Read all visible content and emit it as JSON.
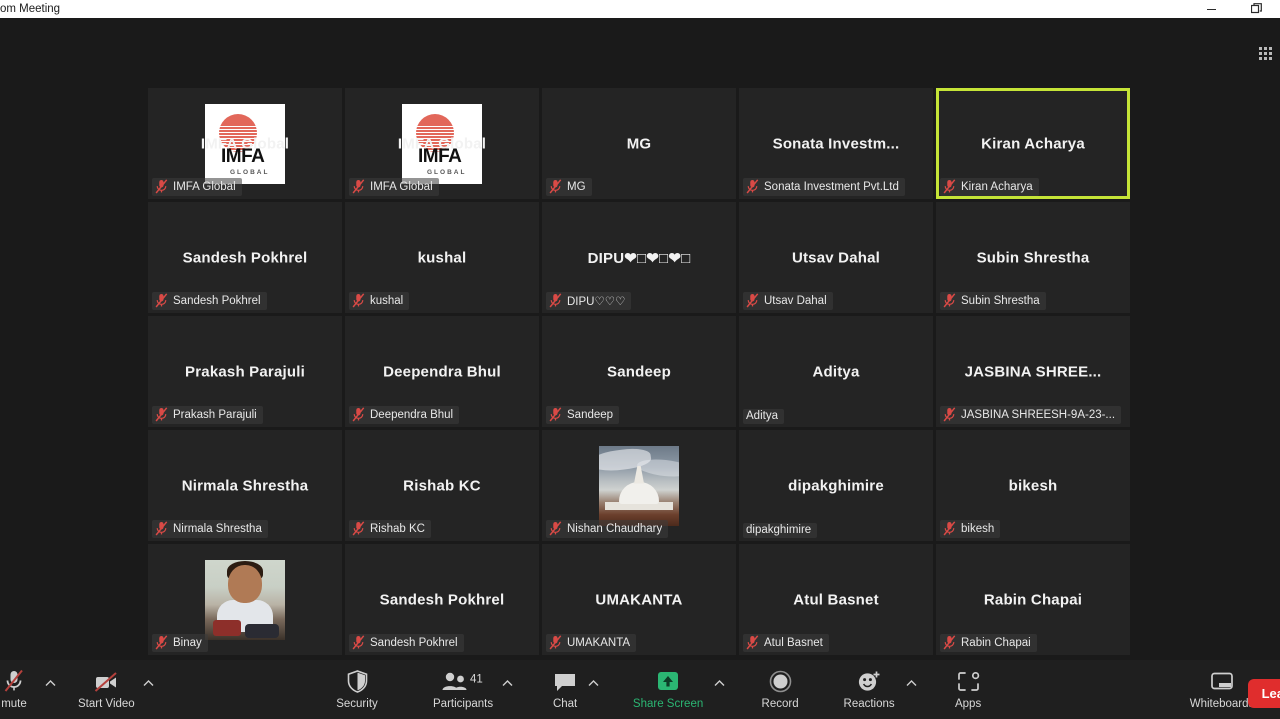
{
  "window": {
    "title": "om Meeting",
    "controls": [
      {
        "name": "minimize-button",
        "glyph": "minimize"
      },
      {
        "name": "restore-button",
        "glyph": "restore"
      }
    ]
  },
  "view": {
    "grid_view_icon": "grid-view-icon"
  },
  "colors": {
    "active_speaker_border": "#c5e437",
    "share_screen_green": "#2bb673",
    "leave_red": "#e02d2d",
    "mute_icon_red": "#d94a46",
    "tile_bg": "#242424",
    "app_bg": "#1a1a1a"
  },
  "gallery": {
    "rows": 5,
    "columns": 5,
    "tiles": [
      {
        "name": "IMFA Global",
        "label": "IMFA Global",
        "muted": true,
        "avatar": "imfa-logo",
        "active": false
      },
      {
        "name": "IMFA Global",
        "label": "IMFA Global",
        "muted": true,
        "avatar": "imfa-logo",
        "active": false
      },
      {
        "name": "MG",
        "label": "MG",
        "muted": true,
        "avatar": "none",
        "active": false
      },
      {
        "name": "Sonata  Investm...",
        "label": "Sonata Investment Pvt.Ltd",
        "muted": true,
        "avatar": "none",
        "active": false
      },
      {
        "name": "Kiran Acharya",
        "label": "Kiran Acharya",
        "muted": true,
        "avatar": "none",
        "active": true
      },
      {
        "name": "Sandesh Pokhrel",
        "label": "Sandesh Pokhrel",
        "muted": true,
        "avatar": "none",
        "active": false
      },
      {
        "name": "kushal",
        "label": "kushal",
        "muted": true,
        "avatar": "none",
        "active": false
      },
      {
        "name": "DIPU❤□❤□❤□",
        "label": "DIPU♡♡♡",
        "muted": true,
        "avatar": "none",
        "active": false
      },
      {
        "name": "Utsav Dahal",
        "label": "Utsav Dahal",
        "muted": true,
        "avatar": "none",
        "active": false
      },
      {
        "name": "Subin Shrestha",
        "label": "Subin Shrestha",
        "muted": true,
        "avatar": "none",
        "active": false
      },
      {
        "name": "Prakash Parajuli",
        "label": "Prakash Parajuli",
        "muted": true,
        "avatar": "none",
        "active": false
      },
      {
        "name": "Deependra Bhul",
        "label": "Deependra Bhul",
        "muted": true,
        "avatar": "none",
        "active": false
      },
      {
        "name": "Sandeep",
        "label": "Sandeep",
        "muted": true,
        "avatar": "none",
        "active": false
      },
      {
        "name": "Aditya",
        "label": "Aditya",
        "muted": false,
        "avatar": "none",
        "active": false
      },
      {
        "name": "JASBINA SHREE...",
        "label": "JASBINA SHREESH-9A-23-...",
        "muted": true,
        "avatar": "none",
        "active": false
      },
      {
        "name": "Nirmala Shrestha",
        "label": "Nirmala Shrestha",
        "muted": true,
        "avatar": "none",
        "active": false
      },
      {
        "name": "Rishab KC",
        "label": "Rishab KC",
        "muted": true,
        "avatar": "none",
        "active": false
      },
      {
        "name": "",
        "label": "Nishan Chaudhary",
        "muted": true,
        "avatar": "stupa-photo",
        "active": false
      },
      {
        "name": "dipakghimire",
        "label": "dipakghimire",
        "muted": false,
        "avatar": "none",
        "active": false
      },
      {
        "name": "bikesh",
        "label": "bikesh",
        "muted": true,
        "avatar": "none",
        "active": false
      },
      {
        "name": "",
        "label": "Binay",
        "muted": true,
        "avatar": "child-photo",
        "active": false
      },
      {
        "name": "Sandesh Pokhrel",
        "label": "Sandesh Pokhrel",
        "muted": true,
        "avatar": "none",
        "active": false
      },
      {
        "name": "UMAKANTA",
        "label": "UMAKANTA",
        "muted": true,
        "avatar": "none",
        "active": false
      },
      {
        "name": "Atul Basnet",
        "label": "Atul Basnet",
        "muted": true,
        "avatar": "none",
        "active": false
      },
      {
        "name": "Rabin Chapai",
        "label": "Rabin Chapai",
        "muted": true,
        "avatar": "none",
        "active": false
      }
    ]
  },
  "toolbar": {
    "unmute": {
      "label": "mute",
      "icon": "microphone-muted-icon",
      "has_caret": true
    },
    "start_video": {
      "label": "Start Video",
      "icon": "video-off-icon",
      "has_caret": true
    },
    "security": {
      "label": "Security",
      "icon": "shield-icon",
      "has_caret": false
    },
    "participants": {
      "label": "Participants",
      "icon": "participants-icon",
      "count": "41",
      "has_caret": true
    },
    "chat": {
      "label": "Chat",
      "icon": "chat-bubble-icon",
      "has_caret": true
    },
    "share_screen": {
      "label": "Share Screen",
      "icon": "share-screen-icon",
      "has_caret": true
    },
    "record": {
      "label": "Record",
      "icon": "record-circle-icon",
      "has_caret": false
    },
    "reactions": {
      "label": "Reactions",
      "icon": "reactions-smiley-icon",
      "has_caret": true
    },
    "apps": {
      "label": "Apps",
      "icon": "apps-icon",
      "has_caret": false
    },
    "whiteboards": {
      "label": "Whiteboards",
      "icon": "whiteboard-icon",
      "has_caret": true
    },
    "leave": {
      "label": "Lea"
    }
  }
}
